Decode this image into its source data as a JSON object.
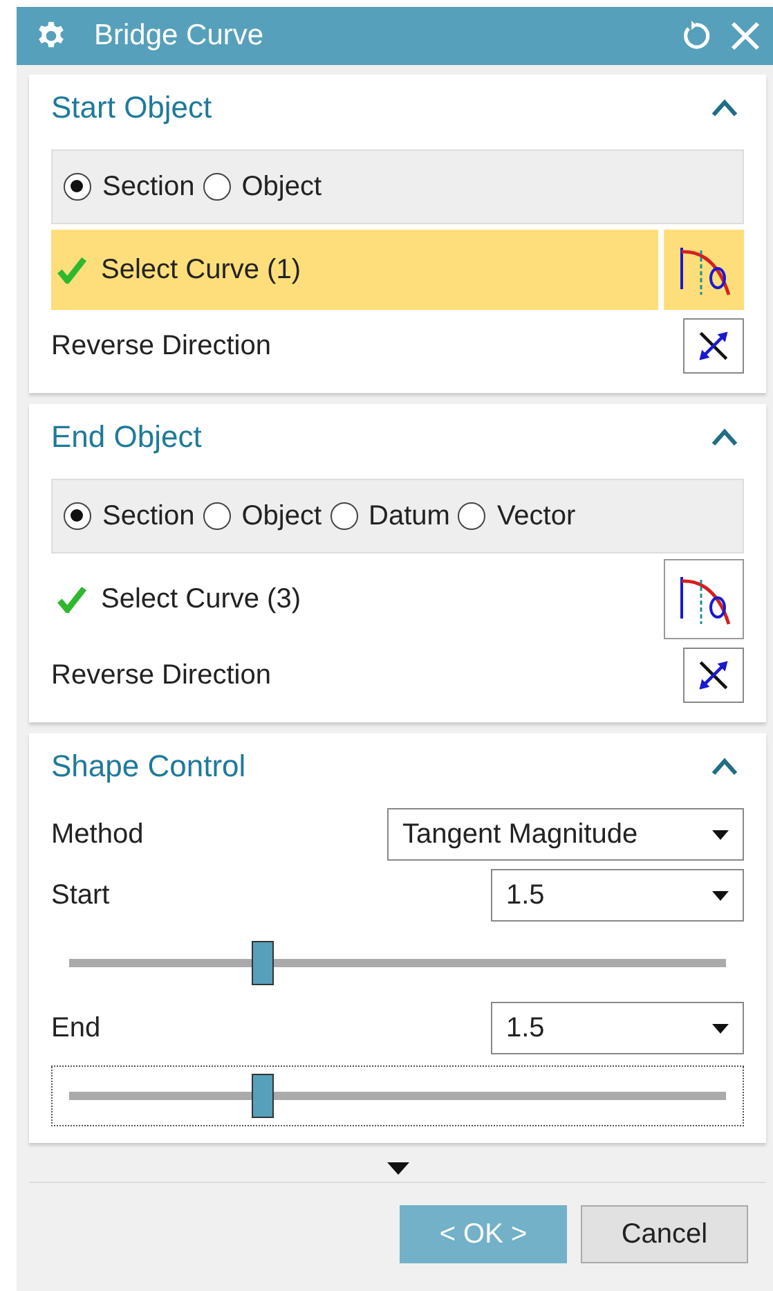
{
  "window": {
    "title": "Bridge Curve"
  },
  "sections": [
    {
      "title": "Start Object",
      "expanded": true,
      "options": [
        {
          "label": "Section",
          "selected": true
        },
        {
          "label": "Object",
          "selected": false
        }
      ],
      "selection": {
        "label": "Select Curve (1)",
        "complete": true,
        "active": true
      },
      "reverse_label": "Reverse Direction"
    },
    {
      "title": "End Object",
      "expanded": true,
      "options": [
        {
          "label": "Section",
          "selected": true
        },
        {
          "label": "Object",
          "selected": false
        },
        {
          "label": "Datum",
          "selected": false
        },
        {
          "label": "Vector",
          "selected": false
        }
      ],
      "selection": {
        "label": "Select Curve (3)",
        "complete": true,
        "active": false
      },
      "reverse_label": "Reverse Direction"
    }
  ],
  "shape_control": {
    "title": "Shape Control",
    "expanded": true,
    "method": {
      "label": "Method",
      "value": "Tangent Magnitude"
    },
    "sliders": [
      {
        "label": "Start",
        "value": "1.5",
        "level": 0.3,
        "focused": false
      },
      {
        "label": "End",
        "value": "1.5",
        "level": 0.3,
        "focused": true
      }
    ]
  },
  "buttons": [
    {
      "label": "< OK >",
      "kind": "primary"
    },
    {
      "label": "Cancel",
      "kind": "secondary"
    }
  ]
}
